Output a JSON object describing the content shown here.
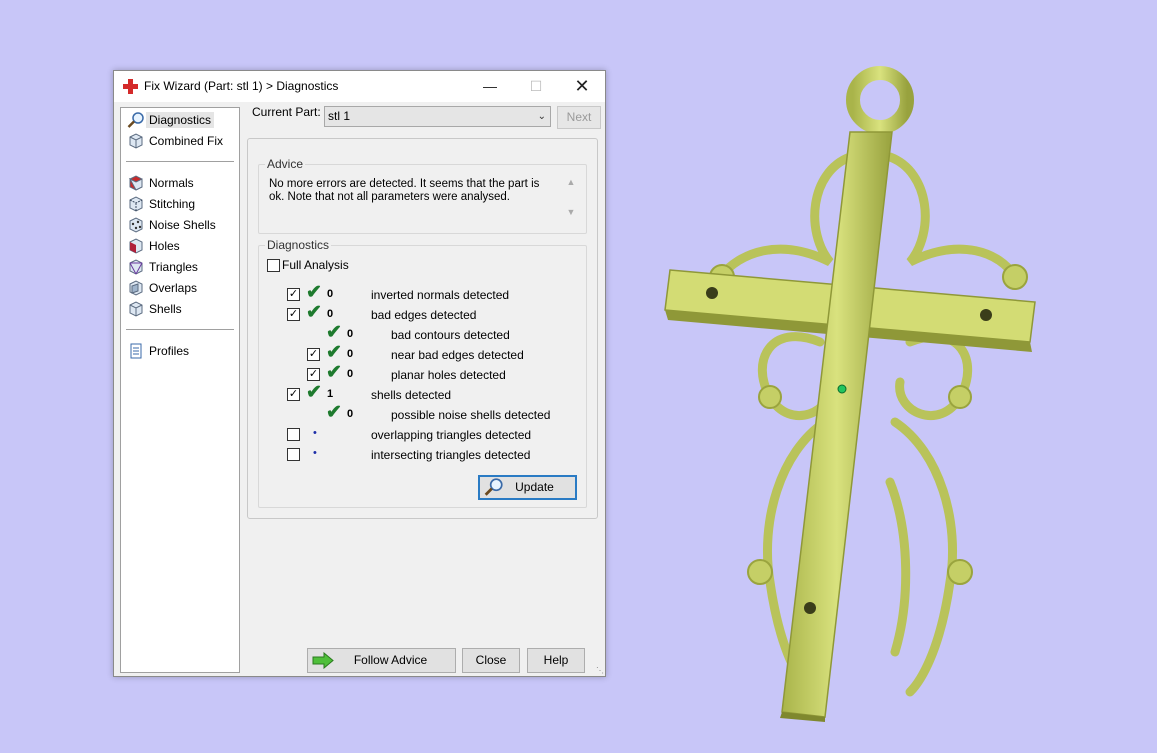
{
  "window": {
    "title": "Fix Wizard (Part: stl 1) > Diagnostics",
    "controls": {
      "minimize": "—",
      "maximize": "☐",
      "close": "✕"
    }
  },
  "sidebar": {
    "top_items": [
      {
        "label": "Diagnostics",
        "icon": "magnifier-icon",
        "selected": true
      },
      {
        "label": "Combined Fix",
        "icon": "cube-icon"
      }
    ],
    "fix_items": [
      {
        "label": "Normals",
        "icon": "normals-cube-icon"
      },
      {
        "label": "Stitching",
        "icon": "stitching-cube-icon"
      },
      {
        "label": "Noise Shells",
        "icon": "noise-shells-icon"
      },
      {
        "label": "Holes",
        "icon": "holes-cube-icon"
      },
      {
        "label": "Triangles",
        "icon": "triangles-cube-icon"
      },
      {
        "label": "Overlaps",
        "icon": "overlaps-cube-icon"
      },
      {
        "label": "Shells",
        "icon": "shells-cube-icon"
      }
    ],
    "bottom_items": [
      {
        "label": "Profiles",
        "icon": "document-icon"
      }
    ]
  },
  "current_part": {
    "label": "Current Part:",
    "value": "stl 1"
  },
  "next_label": "Next",
  "advice": {
    "title": "Advice",
    "text": "No more errors are detected. It seems that the part is ok. Note that not all parameters were analysed."
  },
  "diagnostics": {
    "title": "Diagnostics",
    "full_analysis": "Full Analysis",
    "rows": [
      {
        "checked": true,
        "status": "ok",
        "count": "0",
        "label": "inverted normals detected"
      },
      {
        "checked": true,
        "status": "ok",
        "count": "0",
        "label": "bad edges detected"
      },
      {
        "checked": null,
        "status": "ok",
        "count": "0",
        "label": "bad contours detected"
      },
      {
        "checked": true,
        "status": "ok",
        "count": "0",
        "label": "near bad edges detected"
      },
      {
        "checked": true,
        "status": "ok",
        "count": "0",
        "label": "planar holes detected"
      },
      {
        "checked": true,
        "status": "ok",
        "count": "1",
        "label": "shells detected"
      },
      {
        "checked": null,
        "status": "ok",
        "count": "0",
        "label": "possible noise shells detected"
      },
      {
        "checked": false,
        "status": "pending",
        "count": "",
        "label": "overlapping triangles detected"
      },
      {
        "checked": false,
        "status": "pending",
        "count": "",
        "label": "intersecting triangles detected"
      }
    ],
    "update_label": "Update"
  },
  "footer": {
    "follow_advice": "Follow Advice",
    "close": "Close",
    "help": "Help"
  },
  "colors": {
    "background": "#c8c6f8",
    "model": "#c9d46a",
    "check_green": "#1e7a2e",
    "accent_blue": "#2a7bc4"
  }
}
